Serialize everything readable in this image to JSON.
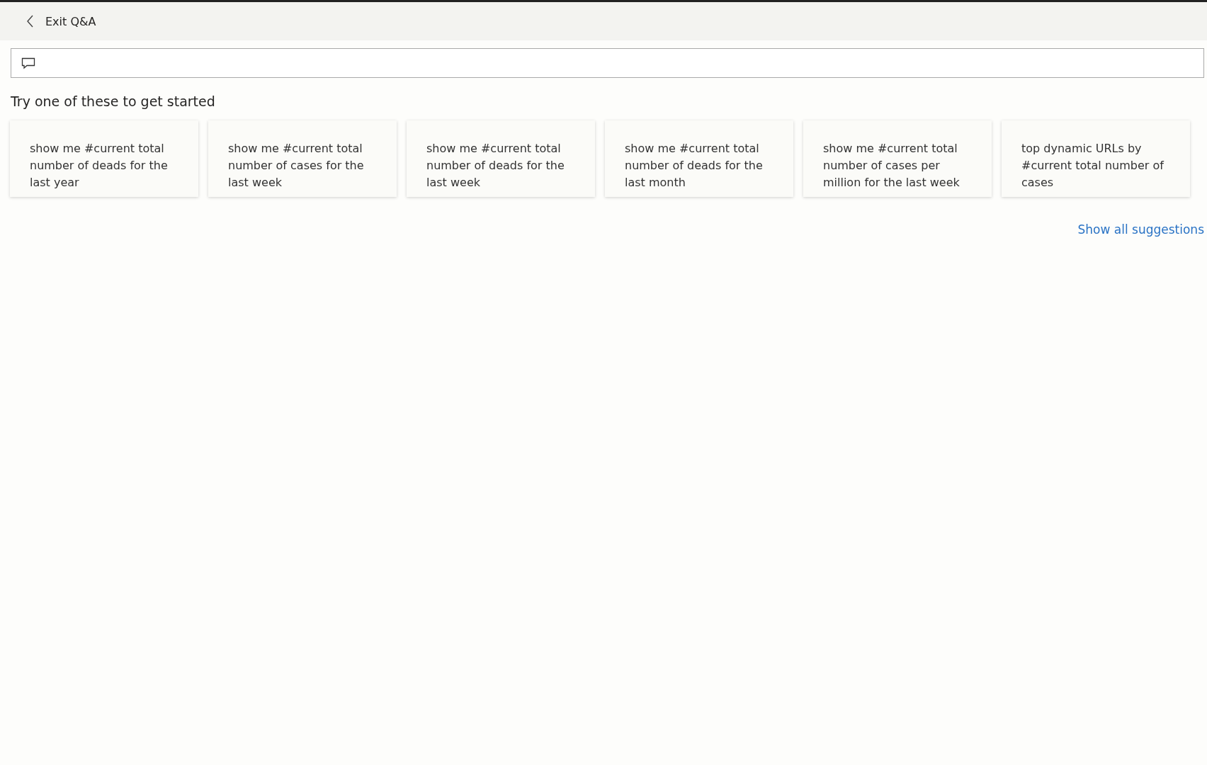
{
  "header": {
    "back_label": "Exit Q&A"
  },
  "suggestions_heading": "Try one of these to get started",
  "suggestions": [
    {
      "text": "show me #current total number of deads for the last year"
    },
    {
      "text": "show me #current total number of cases for the last week"
    },
    {
      "text": "show me #current total number of deads for the last week"
    },
    {
      "text": "show me #current total number of deads for the last month"
    },
    {
      "text": "show me #current total number of cases per million for the last week"
    },
    {
      "text": "top dynamic URLs by #current total number of cases"
    }
  ],
  "show_all_link": "Show all suggestions"
}
